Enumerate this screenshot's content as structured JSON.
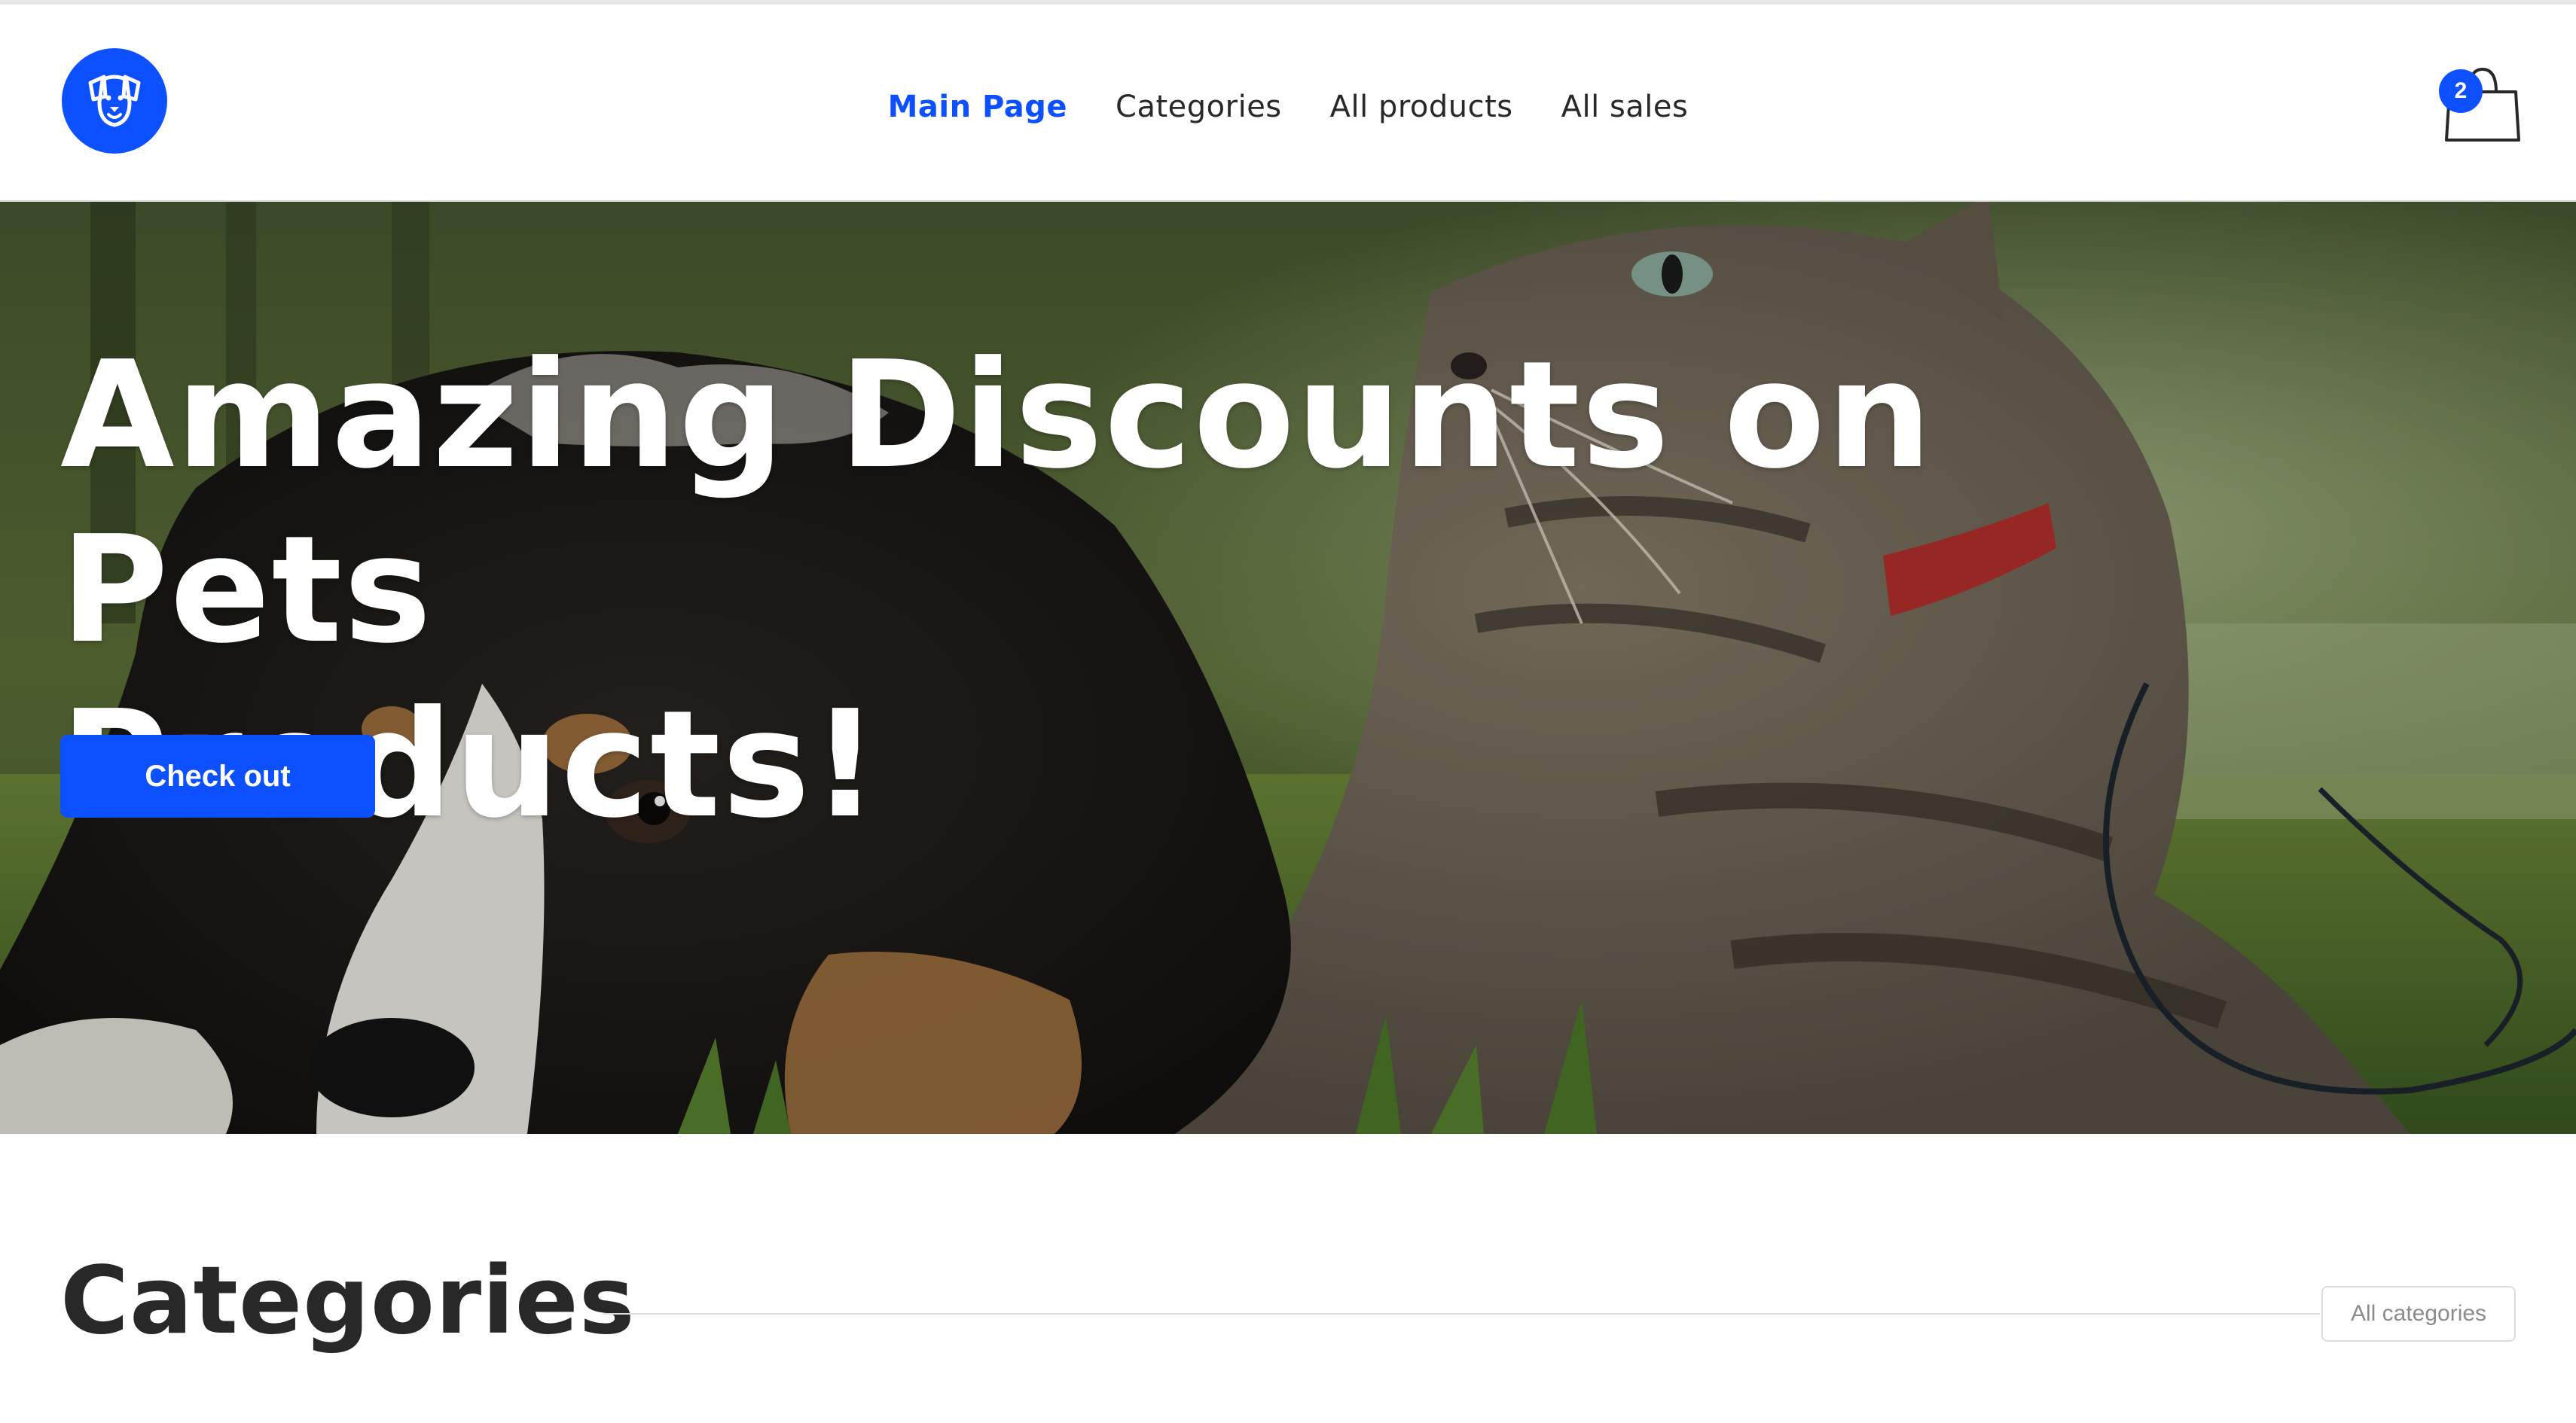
{
  "header": {
    "logo_icon": "dog-face-icon",
    "nav": [
      {
        "label": "Main Page",
        "active": true
      },
      {
        "label": "Categories",
        "active": false
      },
      {
        "label": "All products",
        "active": false
      },
      {
        "label": "All sales",
        "active": false
      }
    ],
    "cart": {
      "icon": "shopping-bag-icon",
      "count": "2"
    }
  },
  "hero": {
    "title_line1": "Amazing Discounts on Pets",
    "title_line2": "Products!",
    "button_label": "Check out"
  },
  "categories_section": {
    "title": "Categories",
    "all_button_label": "All categories"
  },
  "colors": {
    "accent": "#0d50ff",
    "text_dark": "#282828",
    "divider": "#dddddd"
  }
}
